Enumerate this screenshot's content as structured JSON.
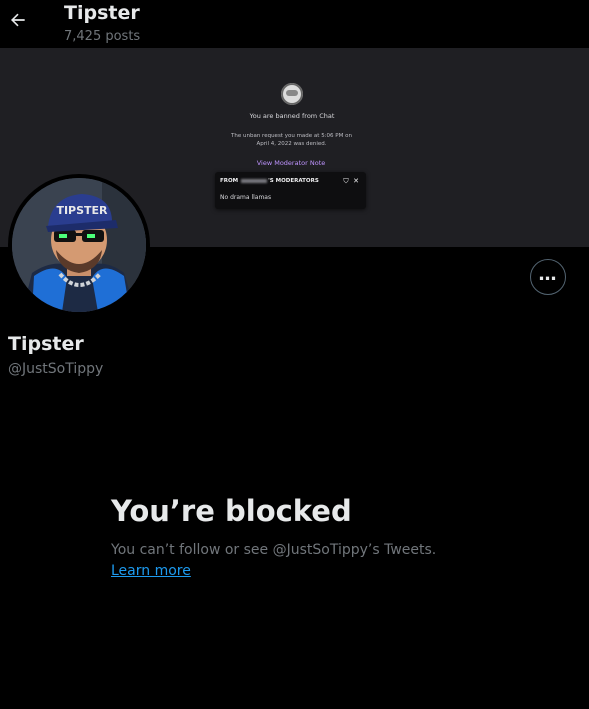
{
  "header": {
    "title": "Tipster",
    "post_count": "7,425 posts",
    "back_icon": "arrow-left-icon"
  },
  "banner": {
    "ban_title": "You are banned from Chat",
    "ban_message": "The unban request you made at 5:06 PM on April 4, 2022 was denied.",
    "view_note": "View Moderator Note",
    "mod_card": {
      "from_prefix": "FROM",
      "from_suffix": "'S MODERATORS",
      "note": "No drama llamas",
      "icons": [
        "shield-icon",
        "close-icon"
      ]
    }
  },
  "profile": {
    "name": "Tipster",
    "handle": "@JustSoTippy",
    "more_icon": "more-horizontal-icon",
    "avatar_cap_text": "TIPSTER"
  },
  "blocked": {
    "title": "You’re blocked",
    "message": "You can’t follow or see @JustSoTippy’s Tweets.",
    "link_text": "Learn more",
    "link_color": "#1d9bf0"
  }
}
